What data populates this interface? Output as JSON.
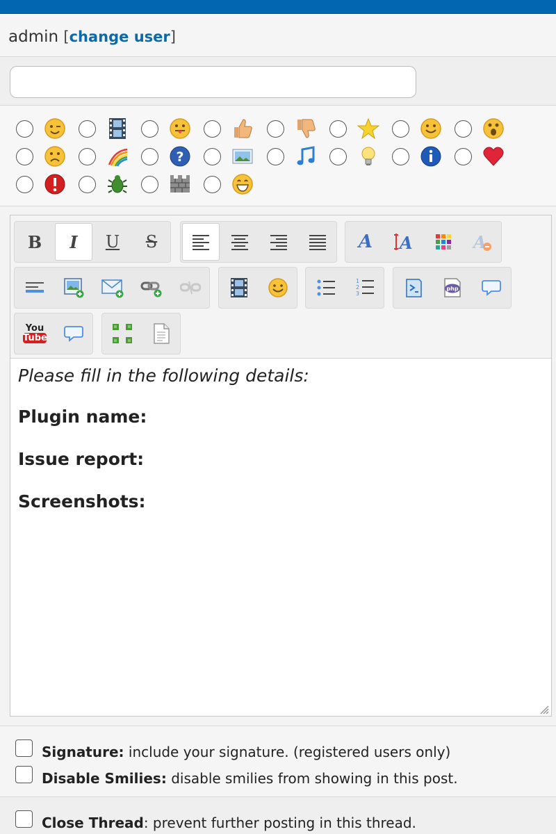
{
  "user": {
    "name": "admin",
    "bracket_open": "[",
    "change_label": "change user",
    "bracket_close": "]"
  },
  "subject": {
    "value": "",
    "placeholder": ""
  },
  "post_icons": [
    {
      "icon": "wink-smiley-icon"
    },
    {
      "icon": "film-icon"
    },
    {
      "icon": "tongue-smiley-icon"
    },
    {
      "icon": "thumbs-up-icon"
    },
    {
      "icon": "thumbs-down-icon"
    },
    {
      "icon": "star-icon"
    },
    {
      "icon": "smile-smiley-icon"
    },
    {
      "icon": "surprised-smiley-icon"
    },
    {
      "icon": "sad-smiley-icon"
    },
    {
      "icon": "rainbow-icon"
    },
    {
      "icon": "question-icon"
    },
    {
      "icon": "image-icon"
    },
    {
      "icon": "music-note-icon"
    },
    {
      "icon": "lightbulb-icon"
    },
    {
      "icon": "info-icon"
    },
    {
      "icon": "heart-icon"
    },
    {
      "icon": "exclamation-icon"
    },
    {
      "icon": "bug-icon"
    },
    {
      "icon": "brick-wall-icon"
    },
    {
      "icon": "grin-smiley-icon"
    }
  ],
  "toolbar": {
    "bold": "B",
    "italic": "I",
    "underline": "U",
    "strike": "S",
    "youtube_top": "You",
    "youtube_bottom": "Tube",
    "php": "php"
  },
  "editor": {
    "intro": "Please fill in the following details:",
    "fields": [
      "Plugin name:",
      "Issue report:",
      "Screenshots:"
    ]
  },
  "options": {
    "signature_label": "Signature:",
    "signature_desc": " include your signature. (registered users only)",
    "smilies_label": "Disable Smilies:",
    "smilies_desc": " disable smilies from showing in this post.",
    "close_label": "Close Thread",
    "close_desc": ": prevent further posting in this thread."
  },
  "colors": {
    "topbar": "#0266b1",
    "link": "#0b6aa8"
  }
}
